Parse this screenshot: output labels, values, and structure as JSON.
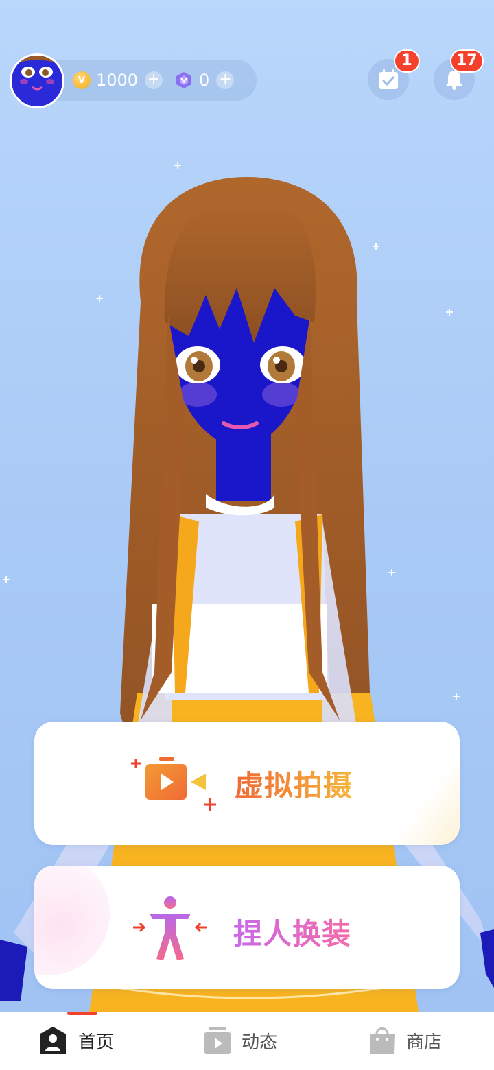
{
  "header": {
    "coins": "1000",
    "gems": "0",
    "calendar_badge": "1",
    "notification_badge": "17"
  },
  "actions": {
    "virtual_shoot_label": "虚拟拍摄",
    "pinch_dress_label": "捏人换装"
  },
  "nav": {
    "items": [
      {
        "label": "首页",
        "icon": "person-icon",
        "active": true
      },
      {
        "label": "动态",
        "icon": "video-icon",
        "active": false
      },
      {
        "label": "商店",
        "icon": "shopping-bag-icon",
        "active": false
      }
    ]
  },
  "colors": {
    "accent": "#f5402c",
    "background": "#aacbf6",
    "shoot_gradient": [
      "#f06a35",
      "#f5b63c"
    ],
    "dress_gradient": [
      "#c86ae8",
      "#f56aa8"
    ]
  }
}
